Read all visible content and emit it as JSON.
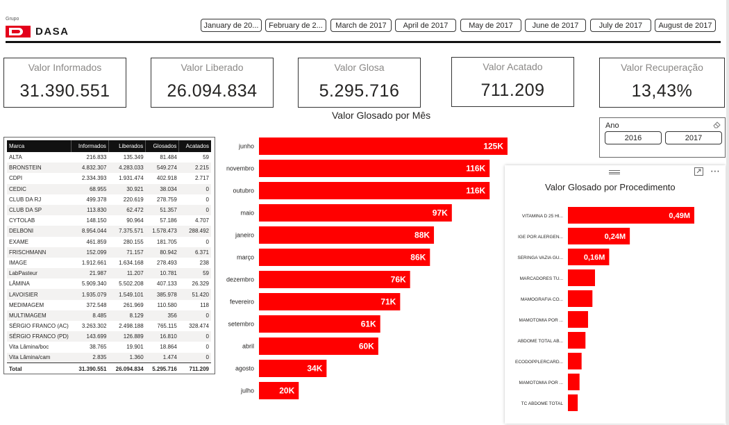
{
  "brand": {
    "group_label": "Grupo",
    "name": "DASA",
    "color": "#e3001b"
  },
  "month_slicer": [
    "January de 20...",
    "February de 2...",
    "March de 2017",
    "April de 2017",
    "May de 2017",
    "June de 2017",
    "July de 2017",
    "August de 2017"
  ],
  "kpis": [
    {
      "label": "Valor Informados",
      "value": "31.390.551"
    },
    {
      "label": "Valor Liberado",
      "value": "26.094.834"
    },
    {
      "label": "Valor Glosa",
      "value": "5.295.716"
    },
    {
      "label": "Valor Acatado",
      "value": "711.209"
    },
    {
      "label": "Valor Recuperação",
      "value": "13,43%"
    }
  ],
  "table": {
    "columns": [
      "Marca",
      "Informados",
      "Liberados",
      "Glosados",
      "Acatados"
    ],
    "rows": [
      [
        "ALTA",
        "216.833",
        "135.349",
        "81.484",
        "59"
      ],
      [
        "BRONSTEIN",
        "4.832.307",
        "4.283.033",
        "549.274",
        "2.215"
      ],
      [
        "CDPI",
        "2.334.393",
        "1.931.474",
        "402.918",
        "2.717"
      ],
      [
        "CEDIC",
        "68.955",
        "30.921",
        "38.034",
        "0"
      ],
      [
        "CLUB DA RJ",
        "499.378",
        "220.619",
        "278.759",
        "0"
      ],
      [
        "CLUB DA SP",
        "113.830",
        "62.472",
        "51.357",
        "0"
      ],
      [
        "CYTOLAB",
        "148.150",
        "90.964",
        "57.186",
        "4.707"
      ],
      [
        "DELBONI",
        "8.954.044",
        "7.375.571",
        "1.578.473",
        "288.492"
      ],
      [
        "EXAME",
        "461.859",
        "280.155",
        "181.705",
        "0"
      ],
      [
        "FRISCHMANN",
        "152.099",
        "71.157",
        "80.942",
        "6.371"
      ],
      [
        "IMAGE",
        "1.912.661",
        "1.634.168",
        "278.493",
        "238"
      ],
      [
        "LabPasteur",
        "21.987",
        "11.207",
        "10.781",
        "59"
      ],
      [
        "LÂMINA",
        "5.909.340",
        "5.502.208",
        "407.133",
        "26.329"
      ],
      [
        "LAVOISIER",
        "1.935.079",
        "1.549.101",
        "385.978",
        "51.420"
      ],
      [
        "MEDIMAGEM",
        "372.548",
        "261.969",
        "110.580",
        "118"
      ],
      [
        "MULTIMAGEM",
        "8.485",
        "8.129",
        "356",
        "0"
      ],
      [
        "SÉRGIO FRANCO (AC)",
        "3.263.302",
        "2.498.188",
        "765.115",
        "328.474"
      ],
      [
        "SÉRGIO FRANCO (PD)",
        "143.699",
        "126.889",
        "16.810",
        "0"
      ],
      [
        "Vita Lâmina/boc",
        "38.765",
        "19.901",
        "18.864",
        "0"
      ],
      [
        "Vita Lâmina/cam",
        "2.835",
        "1.360",
        "1.474",
        "0"
      ]
    ],
    "total": [
      "Total",
      "31.390.551",
      "26.094.834",
      "5.295.716",
      "711.209"
    ]
  },
  "ano_slicer": {
    "title": "Ano",
    "options": [
      "2016",
      "2017"
    ]
  },
  "chart_data": [
    {
      "type": "bar",
      "orientation": "horizontal",
      "title": "Valor Glosado por Mês",
      "categories": [
        "junho",
        "novembro",
        "outubro",
        "maio",
        "janeiro",
        "março",
        "dezembro",
        "fevereiro",
        "setembro",
        "abril",
        "agosto",
        "julho"
      ],
      "values": [
        125000,
        116000,
        116000,
        97000,
        88000,
        86000,
        76000,
        71000,
        61000,
        60000,
        34000,
        20000
      ],
      "data_labels": [
        "125K",
        "116K",
        "116K",
        "97K",
        "88K",
        "86K",
        "76K",
        "71K",
        "61K",
        "60K",
        "34K",
        "20K"
      ],
      "color": "#ff0000",
      "xlim": [
        0,
        125000
      ],
      "grid": false
    },
    {
      "type": "bar",
      "orientation": "horizontal",
      "title": "Valor Glosado por Procedimento",
      "categories": [
        "VITAMINA D 25 HI...",
        "IGE POR ALERGEN...",
        "SERINGA VAZIA GU...",
        "MARCADORES TU...",
        "MAMOGRAFIA CO...",
        "MAMOTOMIA POR ...",
        "ABDOME TOTAL AB...",
        "ECODOPPLERCARD...",
        "MAMOTOMIA POR ...",
        "TC ABDOME TOTAL"
      ],
      "values": [
        490000,
        240000,
        160000,
        105000,
        95000,
        78000,
        68000,
        53000,
        45000,
        38000
      ],
      "data_labels": [
        "0,49M",
        "0,24M",
        "0,16M",
        "",
        "",
        "",
        "",
        "",
        "",
        ""
      ],
      "color": "#ff0000",
      "xlim": [
        0,
        490000
      ],
      "grid": false
    }
  ]
}
